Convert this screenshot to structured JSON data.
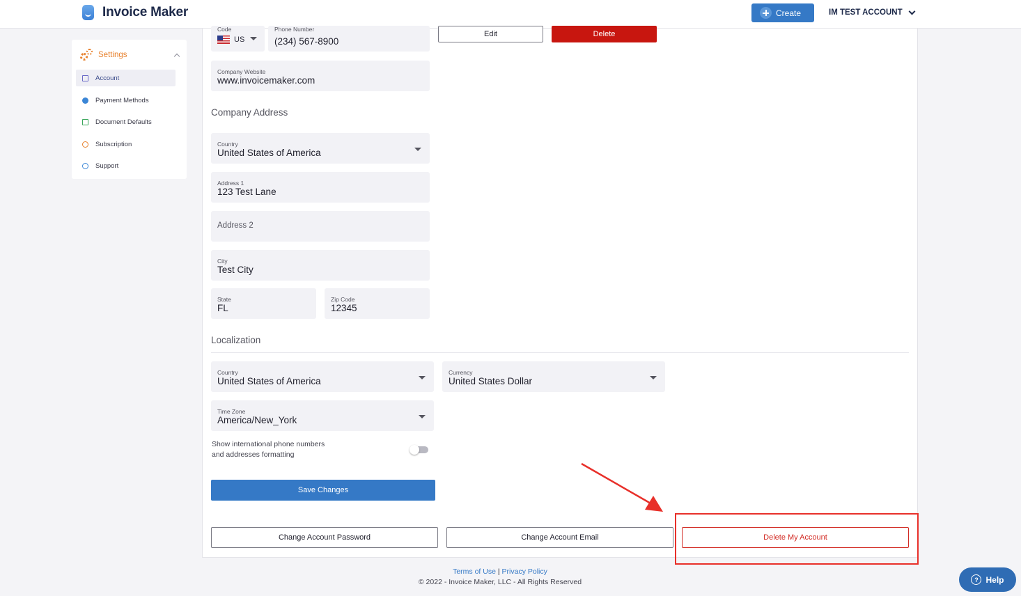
{
  "header": {
    "app_name": "Invoice Maker",
    "create_label": "Create",
    "account_label": "IM TEST ACCOUNT"
  },
  "sidebar": {
    "title": "Settings",
    "items": [
      {
        "label": "Account",
        "icon": "account-icon"
      },
      {
        "label": "Payment Methods",
        "icon": "payment-icon"
      },
      {
        "label": "Document Defaults",
        "icon": "documents-icon"
      },
      {
        "label": "Subscription",
        "icon": "subscription-icon"
      },
      {
        "label": "Support",
        "icon": "support-icon"
      }
    ]
  },
  "logo_actions": {
    "edit_label": "Edit",
    "delete_label": "Delete"
  },
  "contact": {
    "code_label": "Code",
    "code_value": "US",
    "phone_label": "Phone Number",
    "phone_value": "(234) 567-8900",
    "website_label": "Company Website",
    "website_value": "www.invoicemaker.com"
  },
  "company_address": {
    "title": "Company Address",
    "country_label": "Country",
    "country_value": "United States of America",
    "address1_label": "Address 1",
    "address1_value": "123 Test Lane",
    "address2_placeholder": "Address 2",
    "city_label": "City",
    "city_value": "Test City",
    "state_label": "State",
    "state_value": "FL",
    "zip_label": "Zip Code",
    "zip_value": "12345"
  },
  "localization": {
    "title": "Localization",
    "country_label": "Country",
    "country_value": "United States of America",
    "currency_label": "Currency",
    "currency_value": "United States Dollar",
    "timezone_label": "Time Zone",
    "timezone_value": "America/New_York",
    "intl_toggle_line1": "Show international phone numbers",
    "intl_toggle_line2": "and addresses formatting",
    "intl_toggle_on": false
  },
  "actions": {
    "save_label": "Save Changes",
    "change_password_label": "Change Account Password",
    "change_email_label": "Change Account Email",
    "delete_account_label": "Delete My Account"
  },
  "footer": {
    "terms_label": "Terms of Use",
    "separator": "|",
    "privacy_label": "Privacy Policy",
    "copyright": "© 2022 - Invoice Maker, LLC - All Rights Reserved"
  },
  "help": {
    "label": "Help"
  },
  "colors": {
    "primary": "#3579c6",
    "danger": "#c8160f",
    "accent": "#e8822f",
    "annotation": "#e8302a"
  }
}
